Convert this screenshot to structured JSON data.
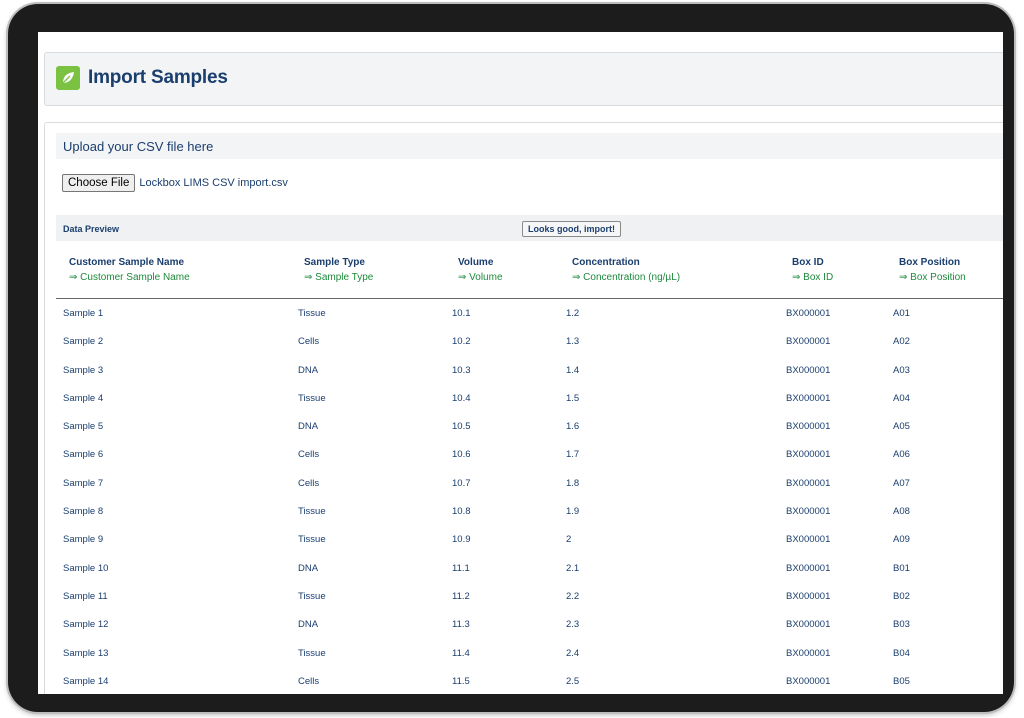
{
  "header": {
    "title": "Import Samples",
    "logo_icon": "leaf-icon",
    "accent": "#7cc242"
  },
  "upload": {
    "label": "Upload your CSV file here",
    "choose_file_label": "Choose File",
    "file_name": "Lockbox LIMS CSV import.csv"
  },
  "preview": {
    "label": "Data Preview",
    "import_label": "Looks good, import!"
  },
  "table": {
    "columns": [
      {
        "name": "Customer Sample Name",
        "mapping": "⇒ Customer Sample Name"
      },
      {
        "name": "Sample Type",
        "mapping": "⇒ Sample Type"
      },
      {
        "name": "Volume",
        "mapping": "⇒ Volume"
      },
      {
        "name": "Concentration",
        "mapping": "⇒ Concentration (ng/µL)"
      },
      {
        "name": "Box ID",
        "mapping": "⇒ Box ID"
      },
      {
        "name": "Box Position",
        "mapping": "⇒ Box Position"
      }
    ],
    "rows": [
      [
        "Sample 1",
        "Tissue",
        "10.1",
        "1.2",
        "BX000001",
        "A01"
      ],
      [
        "Sample 2",
        "Cells",
        "10.2",
        "1.3",
        "BX000001",
        "A02"
      ],
      [
        "Sample 3",
        "DNA",
        "10.3",
        "1.4",
        "BX000001",
        "A03"
      ],
      [
        "Sample 4",
        "Tissue",
        "10.4",
        "1.5",
        "BX000001",
        "A04"
      ],
      [
        "Sample 5",
        "DNA",
        "10.5",
        "1.6",
        "BX000001",
        "A05"
      ],
      [
        "Sample 6",
        "Cells",
        "10.6",
        "1.7",
        "BX000001",
        "A06"
      ],
      [
        "Sample 7",
        "Cells",
        "10.7",
        "1.8",
        "BX000001",
        "A07"
      ],
      [
        "Sample 8",
        "Tissue",
        "10.8",
        "1.9",
        "BX000001",
        "A08"
      ],
      [
        "Sample 9",
        "Tissue",
        "10.9",
        "2",
        "BX000001",
        "A09"
      ],
      [
        "Sample 10",
        "DNA",
        "11.1",
        "2.1",
        "BX000001",
        "B01"
      ],
      [
        "Sample 11",
        "Tissue",
        "11.2",
        "2.2",
        "BX000001",
        "B02"
      ],
      [
        "Sample 12",
        "DNA",
        "11.3",
        "2.3",
        "BX000001",
        "B03"
      ],
      [
        "Sample 13",
        "Tissue",
        "11.4",
        "2.4",
        "BX000001",
        "B04"
      ],
      [
        "Sample 14",
        "Cells",
        "11.5",
        "2.5",
        "BX000001",
        "B05"
      ]
    ]
  }
}
